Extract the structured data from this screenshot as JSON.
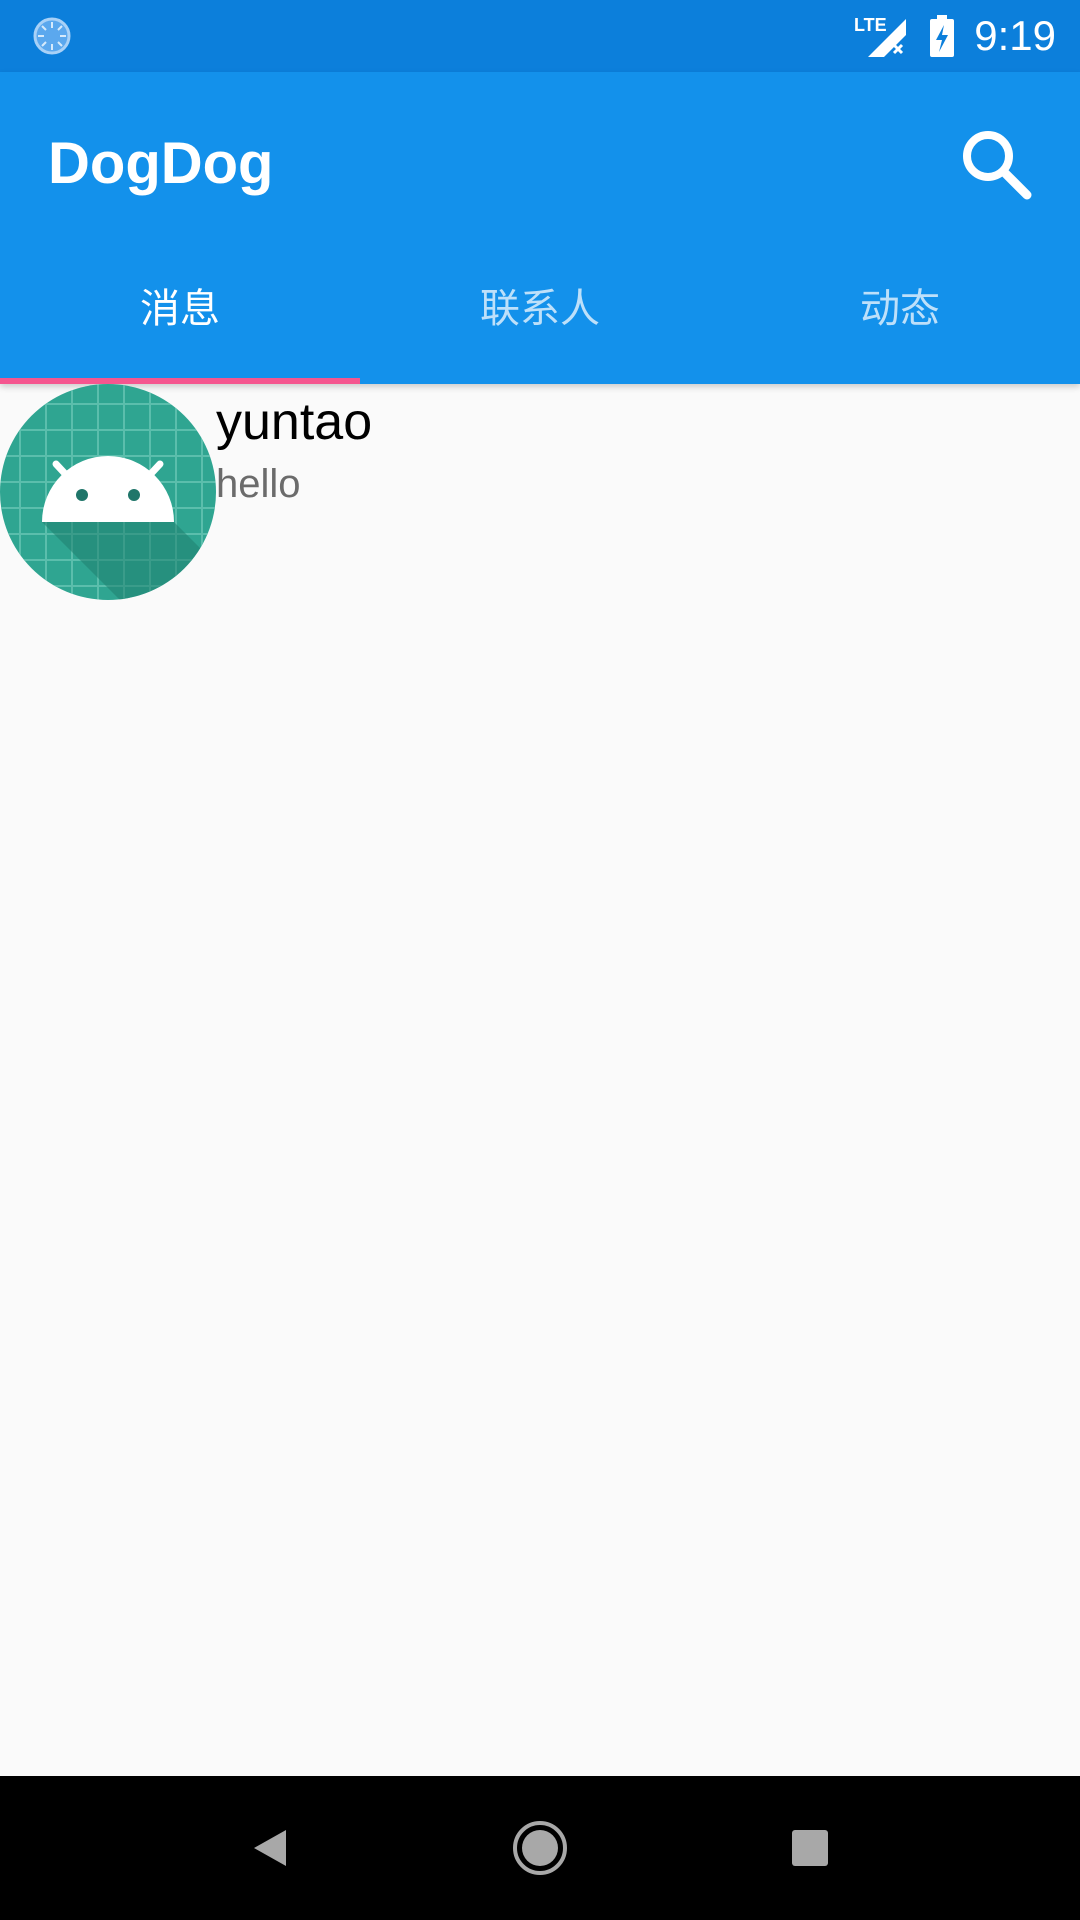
{
  "status_bar": {
    "time": "9:19",
    "network_label": "LTE",
    "left_icon": "loading-spinner-icon",
    "signal_icon": "signal-no-service-icon",
    "battery_icon": "battery-charging-icon"
  },
  "app_bar": {
    "title": "DogDog",
    "search_icon": "search-icon",
    "background_color": "#1391EB"
  },
  "tabs": [
    {
      "label": "消息",
      "active": true
    },
    {
      "label": "联系人",
      "active": false
    },
    {
      "label": "动态",
      "active": false
    }
  ],
  "tab_indicator_color": "#F5568F",
  "conversations": [
    {
      "name": "yuntao",
      "message": "hello",
      "avatar_icon": "android-avatar-icon"
    }
  ],
  "nav_bar": {
    "back_icon": "back-icon",
    "home_icon": "home-icon",
    "recents_icon": "recents-icon"
  }
}
